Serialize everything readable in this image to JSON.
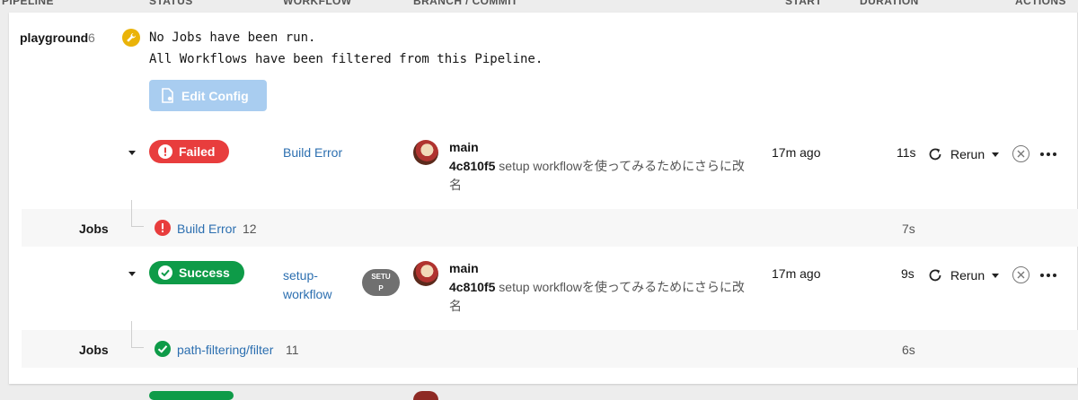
{
  "columns": [
    "PIPELINE",
    "STATUS",
    "WORKFLOW",
    "BRANCH / COMMIT",
    "START",
    "DURATION",
    "ACTIONS"
  ],
  "pipeline": {
    "name": "playground",
    "number": "6",
    "message_line1": "No Jobs have been run.",
    "message_line2": "All Workflows have been filtered from this Pipeline.",
    "edit_config_label": "Edit Config"
  },
  "workflows": [
    {
      "status": "Failed",
      "status_color": "#e83d3d",
      "name": "Build Error",
      "branch": "main",
      "commit_hash": "4c810f5",
      "commit_msg": "setup workflowを使ってみるためにさらに改名",
      "start": "17m ago",
      "duration": "11s",
      "rerun_label": "Rerun",
      "job": {
        "label": "Jobs",
        "name": "Build Error",
        "number": "12",
        "duration": "7s",
        "status": "failed"
      }
    },
    {
      "status": "Success",
      "status_color": "#0e9b48",
      "name_line1": "setup-",
      "name_line2": "workflow",
      "tag_line1": "SETU",
      "tag_line2": "P",
      "branch": "main",
      "commit_hash": "4c810f5",
      "commit_msg": "setup workflowを使ってみるためにさらに改名",
      "start": "17m ago",
      "duration": "9s",
      "rerun_label": "Rerun",
      "job": {
        "label": "Jobs",
        "name": "path-filtering/filter",
        "number": "11",
        "duration": "6s",
        "status": "success"
      }
    }
  ]
}
